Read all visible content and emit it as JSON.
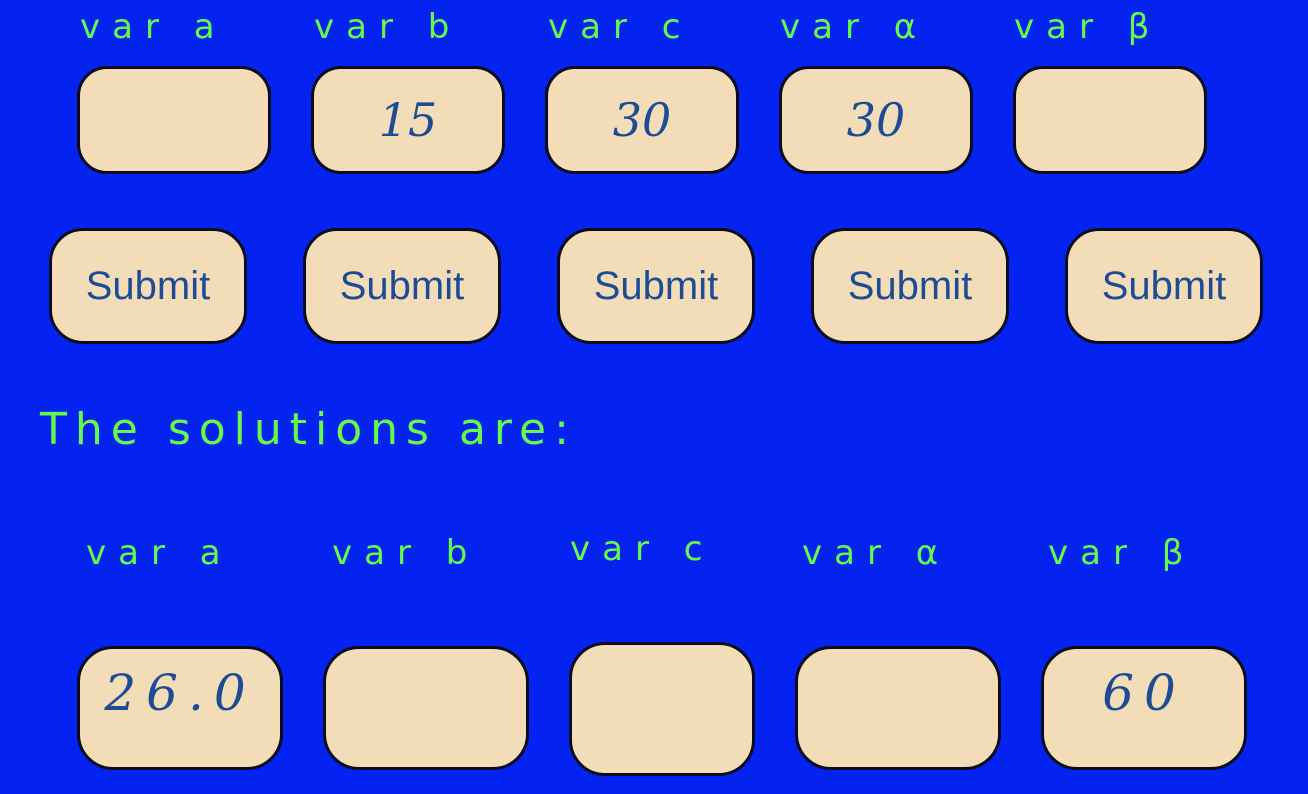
{
  "inputs": [
    {
      "label": "var a",
      "value": ""
    },
    {
      "label": "var b",
      "value": "15"
    },
    {
      "label": "var c",
      "value": "30"
    },
    {
      "label": "var α",
      "value": "30"
    },
    {
      "label": "var β",
      "value": ""
    }
  ],
  "submit_label": "Submit",
  "solutions_heading": "The solutions are:",
  "solutions": [
    {
      "label": "var a",
      "value": "26.0"
    },
    {
      "label": "var b",
      "value": ""
    },
    {
      "label": "var c",
      "value": ""
    },
    {
      "label": "var α",
      "value": ""
    },
    {
      "label": "var β",
      "value": "60"
    }
  ],
  "colors": {
    "background": "#0423f1",
    "label_green": "#66f94a",
    "box_fill": "#f3dcb8",
    "box_text": "#1c4c94",
    "box_border": "#0c0c1c"
  }
}
